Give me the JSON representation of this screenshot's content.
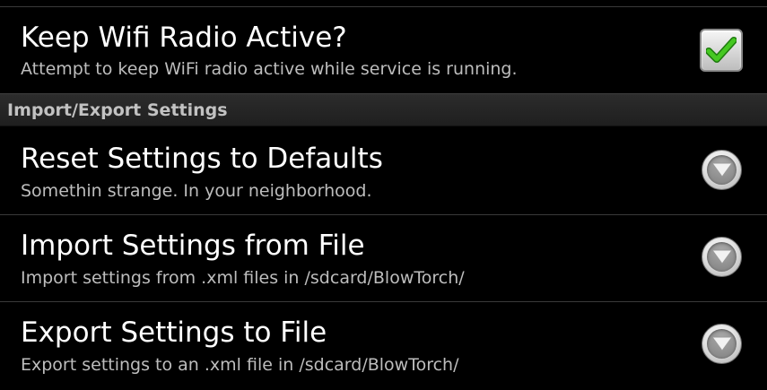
{
  "preferences": {
    "wifi": {
      "title": "Keep Wifi Radio Active?",
      "summary": "Attempt to keep WiFi radio active while service is running.",
      "checked": true
    },
    "category_label": "Import/Export Settings",
    "reset": {
      "title": "Reset Settings to Defaults",
      "summary": "Somethin strange. In your neighborhood."
    },
    "import": {
      "title": "Import Settings from File",
      "summary": "Import settings from .xml files in /sdcard/BlowTorch/"
    },
    "export": {
      "title": "Export Settings to File",
      "summary": "Export settings to an .xml file in /sdcard/BlowTorch/"
    }
  },
  "colors": {
    "background": "#000000",
    "title_text": "#ffffff",
    "summary_text": "#bdbdbd",
    "category_bg": "#2a2a2a",
    "check_green": "#3bbf1e"
  },
  "icons": {
    "checkbox": "checkmark-icon",
    "dropdown": "chevron-down-icon"
  }
}
